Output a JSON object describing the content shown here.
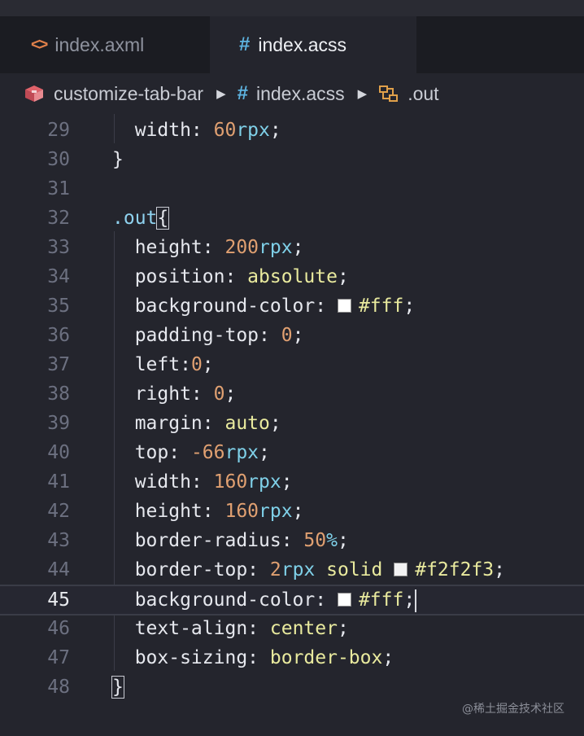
{
  "tabs": [
    {
      "icon": "angle-brackets-icon",
      "label": "index.axml",
      "active": false
    },
    {
      "icon": "hash-icon",
      "label": "index.acss",
      "active": true
    }
  ],
  "breadcrumb": {
    "folder": "customize-tab-bar",
    "file": "index.acss",
    "symbol": ".out"
  },
  "editor": {
    "lines": [
      {
        "n": "29",
        "tokens": [
          [
            "k",
            "  width: "
          ],
          [
            "n",
            "60"
          ],
          [
            "u",
            "rpx"
          ],
          [
            "p",
            ";"
          ]
        ]
      },
      {
        "n": "30",
        "tokens": [
          [
            "p",
            "}"
          ]
        ]
      },
      {
        "n": "31",
        "tokens": []
      },
      {
        "n": "32",
        "tokens": [
          [
            "sel",
            ".out"
          ],
          [
            "bracket",
            "{"
          ]
        ]
      },
      {
        "n": "33",
        "tokens": [
          [
            "k",
            "  height: "
          ],
          [
            "n",
            "200"
          ],
          [
            "u",
            "rpx"
          ],
          [
            "p",
            ";"
          ]
        ]
      },
      {
        "n": "34",
        "tokens": [
          [
            "k",
            "  position: "
          ],
          [
            "v",
            "absolute"
          ],
          [
            "p",
            ";"
          ]
        ]
      },
      {
        "n": "35",
        "tokens": [
          [
            "k",
            "  background-color: "
          ],
          [
            "swatch",
            ""
          ],
          [
            "v",
            "#fff"
          ],
          [
            "p",
            ";"
          ]
        ]
      },
      {
        "n": "36",
        "tokens": [
          [
            "k",
            "  padding-top: "
          ],
          [
            "n",
            "0"
          ],
          [
            "p",
            ";"
          ]
        ]
      },
      {
        "n": "37",
        "tokens": [
          [
            "k",
            "  left:"
          ],
          [
            "n",
            "0"
          ],
          [
            "p",
            ";"
          ]
        ]
      },
      {
        "n": "38",
        "tokens": [
          [
            "k",
            "  right: "
          ],
          [
            "n",
            "0"
          ],
          [
            "p",
            ";"
          ]
        ]
      },
      {
        "n": "39",
        "tokens": [
          [
            "k",
            "  margin: "
          ],
          [
            "v",
            "auto"
          ],
          [
            "p",
            ";"
          ]
        ]
      },
      {
        "n": "40",
        "tokens": [
          [
            "k",
            "  top: "
          ],
          [
            "n",
            "-66"
          ],
          [
            "u",
            "rpx"
          ],
          [
            "p",
            ";"
          ]
        ]
      },
      {
        "n": "41",
        "tokens": [
          [
            "k",
            "  width: "
          ],
          [
            "n",
            "160"
          ],
          [
            "u",
            "rpx"
          ],
          [
            "p",
            ";"
          ]
        ]
      },
      {
        "n": "42",
        "tokens": [
          [
            "k",
            "  height: "
          ],
          [
            "n",
            "160"
          ],
          [
            "u",
            "rpx"
          ],
          [
            "p",
            ";"
          ]
        ]
      },
      {
        "n": "43",
        "tokens": [
          [
            "k",
            "  border-radius: "
          ],
          [
            "n",
            "50"
          ],
          [
            "u",
            "%"
          ],
          [
            "p",
            ";"
          ]
        ]
      },
      {
        "n": "44",
        "tokens": [
          [
            "k",
            "  border-top: "
          ],
          [
            "n",
            "2"
          ],
          [
            "u",
            "rpx"
          ],
          [
            "v",
            " solid "
          ],
          [
            "swatch-alt",
            ""
          ],
          [
            "v",
            "#f2f2f3"
          ],
          [
            "p",
            ";"
          ]
        ]
      },
      {
        "n": "45",
        "tokens": [
          [
            "k",
            "  background-color: "
          ],
          [
            "swatch",
            ""
          ],
          [
            "v",
            "#fff"
          ],
          [
            "p",
            ";"
          ],
          [
            "cursor",
            ""
          ]
        ],
        "active": true
      },
      {
        "n": "46",
        "tokens": [
          [
            "k",
            "  text-align: "
          ],
          [
            "v",
            "center"
          ],
          [
            "p",
            ";"
          ]
        ]
      },
      {
        "n": "47",
        "tokens": [
          [
            "k",
            "  box-sizing: "
          ],
          [
            "v",
            "border-box"
          ],
          [
            "p",
            ";"
          ]
        ]
      },
      {
        "n": "48",
        "tokens": [
          [
            "bracket",
            "}"
          ]
        ]
      }
    ]
  },
  "watermark": "@稀土掘金技术社区",
  "colors": {
    "background": "#24252d",
    "number": "#e0a071",
    "unit": "#7fd0e8",
    "value": "#e9ea9e",
    "selector": "#8fd2ef",
    "hash_icon": "#5db3e0",
    "xml_icon": "#e0804a"
  }
}
